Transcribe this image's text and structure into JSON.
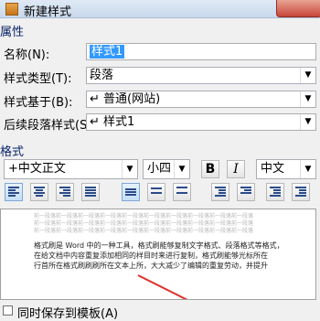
{
  "window": {
    "title": "新建样式"
  },
  "sections": {
    "properties": "属性",
    "format": "格式"
  },
  "properties": {
    "name": {
      "label": "名称(N):",
      "value": "样式1"
    },
    "style_type": {
      "label": "样式类型(T):",
      "value": "段落"
    },
    "based_on": {
      "label": "样式基于(B):",
      "value": "↵ 普通(网站)"
    },
    "following": {
      "label": "后续段落样式(S):",
      "value": "↵ 样式1"
    }
  },
  "format": {
    "font": "+中文正文",
    "size": "小四",
    "bold": "B",
    "italic": "I",
    "script": "中文"
  },
  "preview": {
    "light_lines": [
      "前一段落前一段落前一段落前一段落前一段落前一段落前一段落前一段落前一段落前一段落",
      "前一段落前一段落前一段落前一段落前一段落前一段落前一段落前一段落前一段落前一段落",
      "前一段落前一段落前一段落前一段落前一段落前一段落前一段落前一段落前一段落前一段落"
    ],
    "main_lines": [
      "格式刷是 Word 中的一种工具，格式刷能够复制文字格式、段落格式等格式，",
      "在给文档中内容重复添加相同的样目时来进行复制，格式刷能够光标所在",
      "行首所在格式刷刷刷所在文本上所，大大减少了编辑的重复劳动，并提升"
    ]
  },
  "add_to_template": {
    "label": "同时保存到模板(A)"
  }
}
